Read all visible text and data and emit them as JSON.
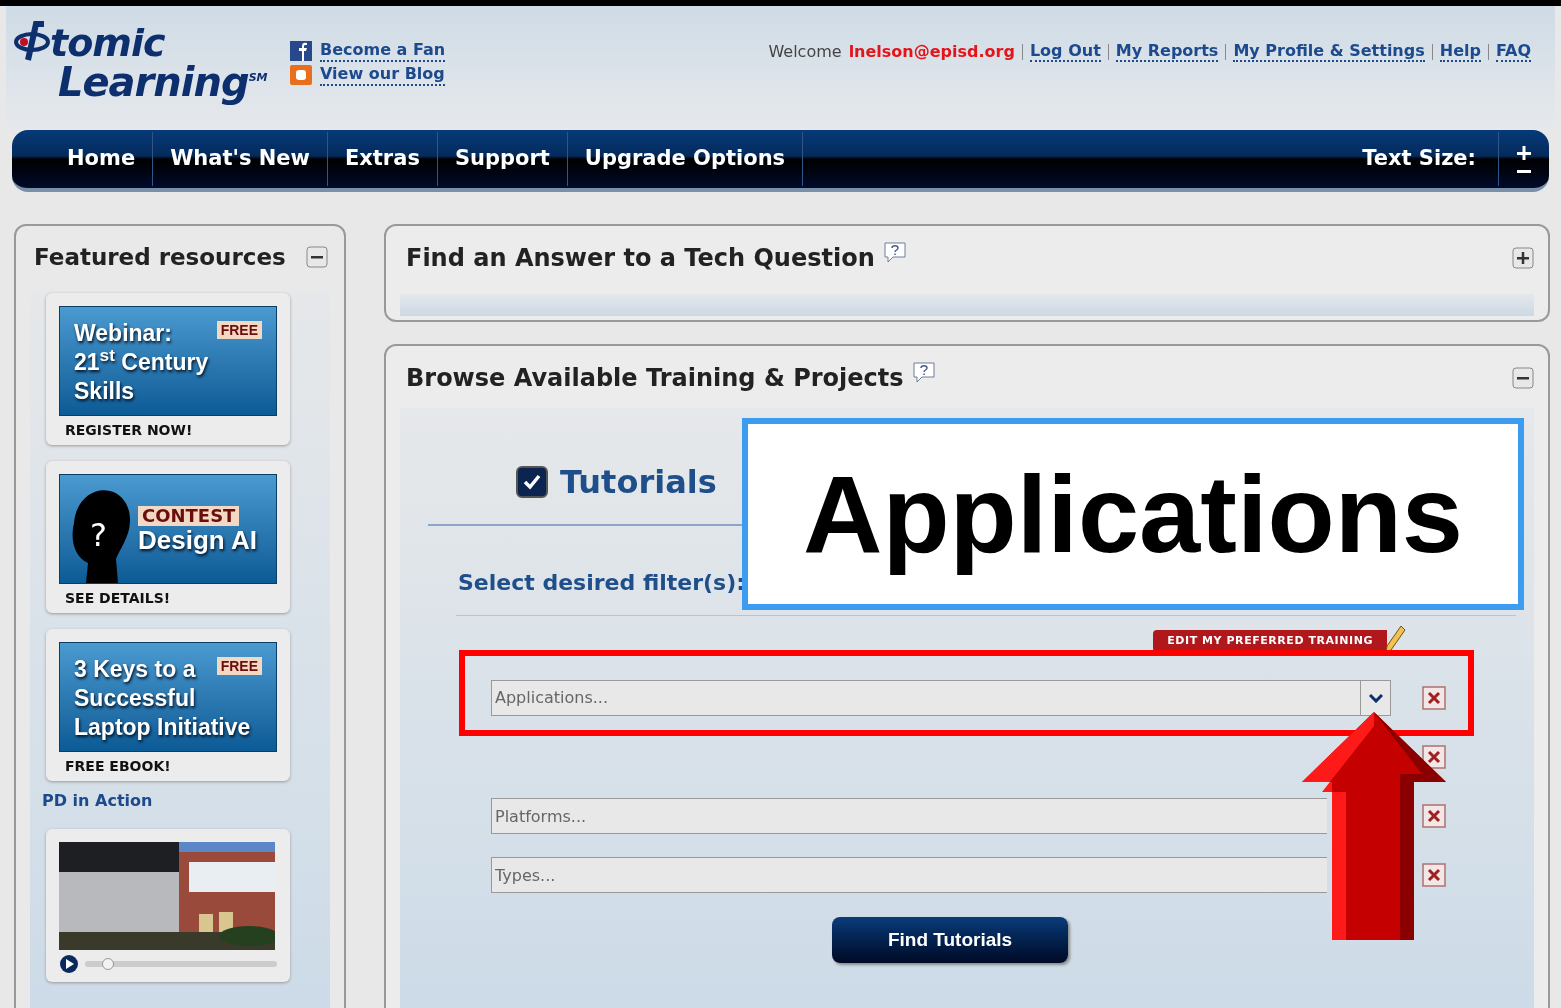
{
  "logo": {
    "word1": "tomic",
    "word2": "Learning",
    "mark": "SM"
  },
  "social_links": [
    {
      "kind": "facebook",
      "label": "Become a Fan"
    },
    {
      "kind": "blog",
      "label": "View our Blog"
    }
  ],
  "welcome": "Welcome",
  "user_email": "lnelson@episd.org",
  "top_links": [
    "Log Out",
    "My Reports",
    "My Profile & Settings",
    "Help",
    "FAQ"
  ],
  "nav": {
    "items": [
      "Home",
      "What's New",
      "Extras",
      "Support",
      "Upgrade Options"
    ],
    "text_size_label": "Text Size:"
  },
  "sidebar": {
    "title": "Featured resources",
    "expanded": true,
    "cards": [
      {
        "kind": "banner",
        "badge": "FREE",
        "lines": [
          "Webinar:",
          "21$^{st}$ Century",
          "Skills"
        ],
        "caption": "REGISTER NOW!"
      },
      {
        "kind": "contest",
        "badge": "CONTEST",
        "mark": "?",
        "lines": [
          "Design AI"
        ],
        "caption": "SEE DETAILS!"
      },
      {
        "kind": "banner",
        "badge": "FREE",
        "lines": [
          "3 Keys to a",
          "Successful",
          "Laptop Initiative"
        ],
        "caption": "FREE EBOOK!"
      }
    ],
    "section": "PD in Action",
    "video": {
      "kind": "picture",
      "level": 0.12
    }
  },
  "panels": [
    {
      "title": "Find an Answer to a Tech Question",
      "expanded": false
    },
    {
      "title": "Browse Available Training & Projects",
      "expanded": true
    }
  ],
  "tab": {
    "label": "Tutorials",
    "checked": true
  },
  "filter_label": "Select desired filter(s):",
  "edit_button": "EDIT MY PREFERRED TRAINING",
  "filters": [
    {
      "kind": "dropdown",
      "placeholder": "Applications..."
    },
    {
      "kind": "empty"
    },
    {
      "kind": "field",
      "placeholder": "Platforms..."
    },
    {
      "kind": "field",
      "placeholder": "Types..."
    }
  ],
  "find_button": "Find Tutorials",
  "callout": "Applications"
}
